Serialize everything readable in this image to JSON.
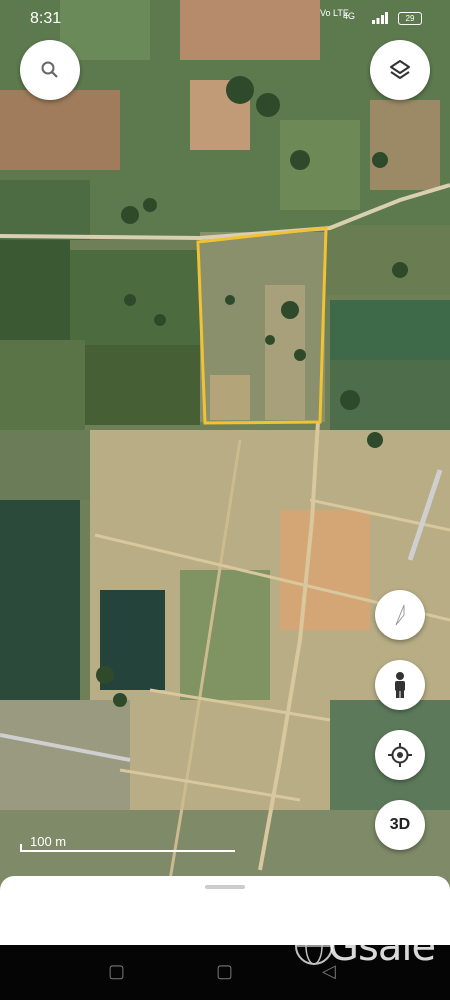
{
  "status_bar": {
    "time": "8:31",
    "network": "Vo LTE",
    "signal_type": "4G",
    "battery": "29"
  },
  "map": {
    "scale_label": "100 m",
    "parcel_outline_color": "#f1c232",
    "three_d_label": "3D"
  },
  "icons": {
    "search": "search-icon",
    "layers": "layers-icon",
    "compass": "compass-icon",
    "street_view": "person-icon",
    "my_location": "location-icon"
  },
  "navbar": {
    "menu": "▢",
    "home": "▢",
    "back": "◁"
  },
  "watermark": {
    "text": "Gsale"
  }
}
